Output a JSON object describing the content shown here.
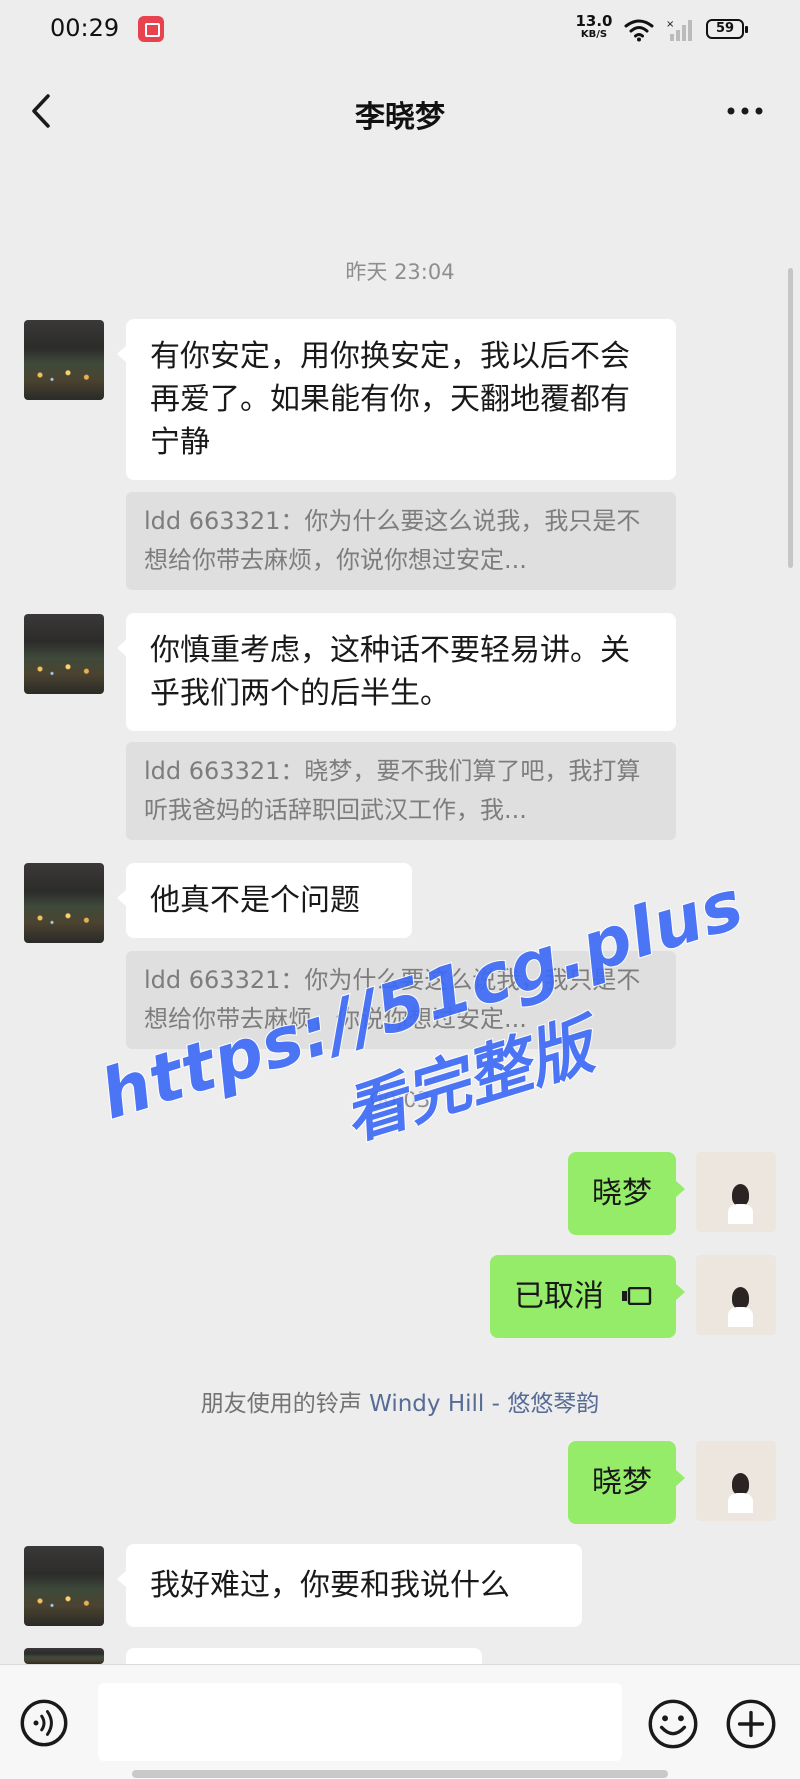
{
  "status_bar": {
    "time": "00:29",
    "speed_value": "13.0",
    "speed_unit": "KB/S",
    "battery": "59"
  },
  "header": {
    "title": "李晓梦",
    "back_icon": "chevron-left-icon",
    "more_icon": "more-dots-icon"
  },
  "messages": [
    {
      "type": "timestamp",
      "text": "昨天 23:04"
    },
    {
      "type": "incoming",
      "text": "有你安定，用你换安定，我以后不会再爱了。如果能有你，天翻地覆都有宁静",
      "quote": "ldd 663321：你为什么要这么说我，我只是不想给你带去麻烦，你说你想过安定..."
    },
    {
      "type": "incoming",
      "text": "你慎重考虑，这种话不要轻易讲。关乎我们两个的后半生。",
      "quote": "ldd 663321：晓梦，要不我们算了吧，我打算听我爸妈的话辞职回武汉工作，我..."
    },
    {
      "type": "incoming",
      "text": "他真不是个问题",
      "quote": "ldd 663321：你为什么要这么说我，我只是不想给你带去麻烦，你说你想过安定..."
    },
    {
      "type": "timestamp",
      "text": "00:03"
    },
    {
      "type": "outgoing",
      "text": "晓梦"
    },
    {
      "type": "outgoing",
      "text": "已取消",
      "icon": "voice-call-cancelled-icon"
    },
    {
      "type": "system",
      "prefix": "朋友使用的铃声 ",
      "song": "Windy Hill - 悠悠琴韵"
    },
    {
      "type": "outgoing",
      "text": "晓梦"
    },
    {
      "type": "incoming",
      "text": "我好难过，你要和我说什么"
    }
  ],
  "watermark": {
    "url": "https://51cg.plus",
    "subtitle": "看完整版"
  },
  "input_bar": {
    "value": "",
    "voice_icon": "voice-mode-icon",
    "emoji_icon": "emoji-icon",
    "plus_icon": "plus-icon"
  },
  "colors": {
    "background": "#ededed",
    "outgoing_bubble": "#95ec69",
    "incoming_bubble": "#ffffff",
    "quote_bg": "#dfdfdf",
    "link": "#576b95",
    "watermark": "#3e6bf5"
  }
}
